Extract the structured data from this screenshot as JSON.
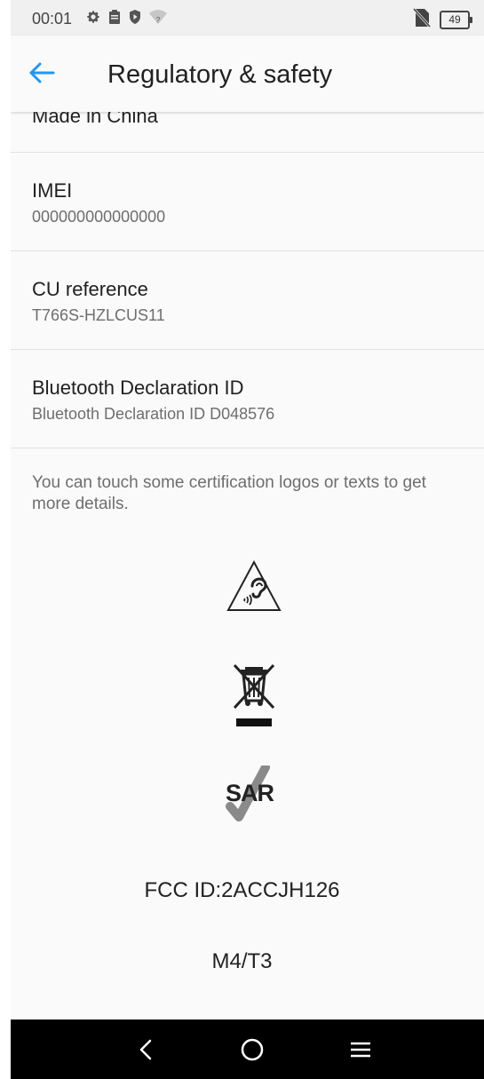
{
  "status_bar": {
    "time": "00:01",
    "battery": "49",
    "icons": [
      "gear-icon",
      "clipboard-icon",
      "shield-icon",
      "wifi-unknown-icon",
      "no-sim-icon"
    ]
  },
  "header": {
    "title": "Regulatory & safety",
    "back_icon": "arrow-left-icon",
    "accent_color": "#2196f3"
  },
  "items": [
    {
      "title": "Made in China",
      "subtitle": ""
    },
    {
      "title": "IMEI",
      "subtitle": "000000000000000"
    },
    {
      "title": "CU reference",
      "subtitle": "T766S-HZLCUS11"
    },
    {
      "title": "Bluetooth Declaration ID",
      "subtitle": "Bluetooth Declaration ID D048576"
    }
  ],
  "note": "You can touch some certification logos or texts to get more details.",
  "logos": {
    "hearing": "hearing-warning-icon",
    "weee": "crossed-bin-icon",
    "sar_text": "SAR"
  },
  "fcc_id": "FCC ID:2ACCJH126",
  "hac_rating": "M4/T3",
  "nav_bar": {
    "icons": [
      "back-icon",
      "home-icon",
      "menu-icon"
    ]
  }
}
